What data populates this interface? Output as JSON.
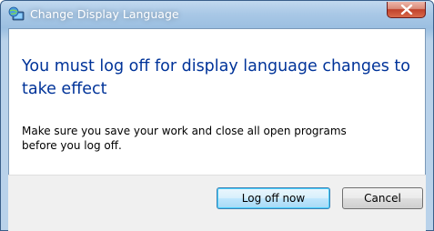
{
  "window": {
    "title": "Change Display Language",
    "title_icon": "globe-display-icon",
    "close_icon": "close-icon"
  },
  "dialog": {
    "main_instruction": "You must log off for display language changes to take effect",
    "content_line1": "Make sure you save your work and close all open programs",
    "content_line2": "before you log off."
  },
  "buttons": {
    "log_off_label": "Log off now",
    "cancel_label": "Cancel"
  },
  "colors": {
    "main_instruction": "#003399",
    "close_button": "#c0412a"
  }
}
